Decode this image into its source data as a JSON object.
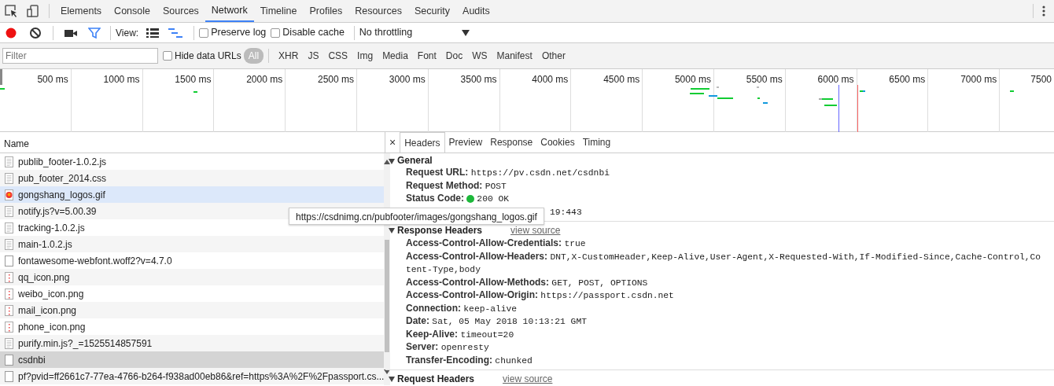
{
  "tabs": [
    {
      "label": "Elements",
      "selected": false
    },
    {
      "label": "Console",
      "selected": false
    },
    {
      "label": "Sources",
      "selected": false
    },
    {
      "label": "Network",
      "selected": true
    },
    {
      "label": "Timeline",
      "selected": false
    },
    {
      "label": "Profiles",
      "selected": false
    },
    {
      "label": "Resources",
      "selected": false
    },
    {
      "label": "Security",
      "selected": false
    },
    {
      "label": "Audits",
      "selected": false
    }
  ],
  "toolbar": {
    "recording": true,
    "filter_active": true,
    "view_label": "View:",
    "view_modes": [
      {
        "kind": "list",
        "selected": false
      },
      {
        "kind": "waterfall",
        "selected": true
      }
    ],
    "checkboxes": [
      {
        "label": "Preserve log",
        "checked": false
      },
      {
        "label": "Disable cache",
        "checked": false
      }
    ],
    "throttling": "No throttling"
  },
  "filter_bar": {
    "placeholder": "Filter",
    "hide_data_urls": {
      "label": "Hide data URLs",
      "checked": false
    },
    "types": [
      {
        "label": "All",
        "selected": true
      },
      {
        "label": "XHR",
        "selected": false
      },
      {
        "label": "JS",
        "selected": false
      },
      {
        "label": "CSS",
        "selected": false
      },
      {
        "label": "Img",
        "selected": false
      },
      {
        "label": "Media",
        "selected": false
      },
      {
        "label": "Font",
        "selected": false
      },
      {
        "label": "Doc",
        "selected": false
      },
      {
        "label": "WS",
        "selected": false
      },
      {
        "label": "Manifest",
        "selected": false
      },
      {
        "label": "Other",
        "selected": false
      }
    ]
  },
  "overview": {
    "ticks": [
      "500 ms",
      "1000 ms",
      "1500 ms",
      "2000 ms",
      "2500 ms",
      "3000 ms",
      "3500 ms",
      "4000 ms",
      "4500 ms",
      "5000 ms",
      "5500 ms",
      "6000 ms",
      "6500 ms",
      "7000 ms",
      "7500"
    ]
  },
  "requests": {
    "column": "Name",
    "rows": [
      {
        "name": "publib_footer-1.0.2.js",
        "kind": "text",
        "hovered": false,
        "selected": false
      },
      {
        "name": "pub_footer_2014.css",
        "kind": "text",
        "hovered": false,
        "selected": false
      },
      {
        "name": "gongshang_logos.gif",
        "kind": "gif",
        "hovered": true,
        "selected": false
      },
      {
        "name": "notify.js?v=5.00.39",
        "kind": "text",
        "hovered": false,
        "selected": false
      },
      {
        "name": "tracking-1.0.2.js",
        "kind": "text",
        "hovered": false,
        "selected": false
      },
      {
        "name": "main-1.0.2.js",
        "kind": "text",
        "hovered": false,
        "selected": false
      },
      {
        "name": "fontawesome-webfont.woff2?v=4.7.0",
        "kind": "blank",
        "hovered": false,
        "selected": false
      },
      {
        "name": "qq_icon.png",
        "kind": "png",
        "hovered": false,
        "selected": false
      },
      {
        "name": "weibo_icon.png",
        "kind": "png",
        "hovered": false,
        "selected": false
      },
      {
        "name": "mail_icon.png",
        "kind": "png",
        "hovered": false,
        "selected": false
      },
      {
        "name": "phone_icon.png",
        "kind": "png",
        "hovered": false,
        "selected": false
      },
      {
        "name": "purify.min.js?_=1525514857591",
        "kind": "text",
        "hovered": false,
        "selected": false
      },
      {
        "name": "csdnbi",
        "kind": "blank",
        "hovered": false,
        "selected": true
      },
      {
        "name": "pf?pvid=ff2661c7-77ea-4766-b264-f938ad00eb86&ref=https%3A%2F%2Fpassport.cs...",
        "kind": "blank",
        "hovered": false,
        "selected": false
      }
    ]
  },
  "tooltip": "https://csdnimg.cn/pubfooter/images/gongshang_logos.gif",
  "details": {
    "close": "×",
    "tabs": [
      {
        "label": "Headers",
        "selected": true
      },
      {
        "label": "Preview",
        "selected": false
      },
      {
        "label": "Response",
        "selected": false
      },
      {
        "label": "Cookies",
        "selected": false
      },
      {
        "label": "Timing",
        "selected": false
      }
    ],
    "sections": [
      {
        "title": "General",
        "expanded": true,
        "rows": [
          {
            "key": "Request URL:",
            "value": "https://pv.csdn.net/csdnbi"
          },
          {
            "key": "Request Method:",
            "value": "POST"
          },
          {
            "key": "Status Code:",
            "value": "200 OK",
            "color": "#1db83b"
          },
          {
            "value": "19:443"
          }
        ]
      },
      {
        "title": "Response Headers",
        "expanded": true,
        "view_source": "view source",
        "rows": [
          {
            "key": "Access-Control-Allow-Credentials:",
            "value": "true"
          },
          {
            "key": "Access-Control-Allow-Headers:",
            "value": "DNT,X-CustomHeader,Keep-Alive,User-Agent,X-Requested-With,If-Modified-Since,Cache-Control,Co\ntent-Type,body"
          },
          {
            "key": "Access-Control-Allow-Methods:",
            "value": "GET, POST, OPTIONS"
          },
          {
            "key": "Access-Control-Allow-Origin:",
            "value": "https://passport.csdn.net"
          },
          {
            "key": "Connection:",
            "value": "keep-alive"
          },
          {
            "key": "Date:",
            "value": "Sat, 05 May 2018 10:13:21 GMT"
          },
          {
            "key": "Keep-Alive:",
            "value": "timeout=20"
          },
          {
            "key": "Server:",
            "value": "openresty"
          },
          {
            "key": "Transfer-Encoding:",
            "value": "chunked"
          }
        ]
      },
      {
        "title": "Request Headers",
        "expanded": true,
        "view_source": "view source"
      }
    ]
  }
}
